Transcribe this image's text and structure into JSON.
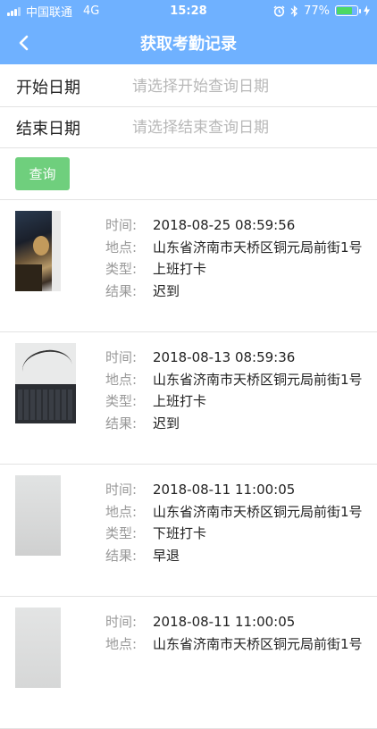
{
  "status_bar": {
    "carrier": "中国联通",
    "network": "4G",
    "time": "15:28",
    "battery_percent": "77%",
    "battery_level": 0.77
  },
  "nav": {
    "title": "获取考勤记录",
    "back_icon": "chevron-left-icon"
  },
  "form": {
    "start_label": "开始日期",
    "start_placeholder": "请选择开始查询日期",
    "end_label": "结束日期",
    "end_placeholder": "请选择结束查询日期",
    "query_button": "查询"
  },
  "labels": {
    "time": "时间:",
    "location": "地点:",
    "type": "类型:",
    "result": "结果:"
  },
  "records": [
    {
      "time": "2018-08-25 08:59:56",
      "location": "山东省济南市天桥区铜元局前街1号",
      "type": "上班打卡",
      "result": "迟到"
    },
    {
      "time": "2018-08-13 08:59:36",
      "location": "山东省济南市天桥区铜元局前街1号",
      "type": "上班打卡",
      "result": "迟到"
    },
    {
      "time": "2018-08-11 11:00:05",
      "location": "山东省济南市天桥区铜元局前街1号",
      "type": "下班打卡",
      "result": "早退"
    },
    {
      "time": "2018-08-11 11:00:05",
      "location": "山东省济南市天桥区铜元局前街1号",
      "type": "",
      "result": ""
    }
  ],
  "colors": {
    "header": "#6fb1ff",
    "query_button": "#6fcf7d",
    "label_gray": "#999999"
  }
}
